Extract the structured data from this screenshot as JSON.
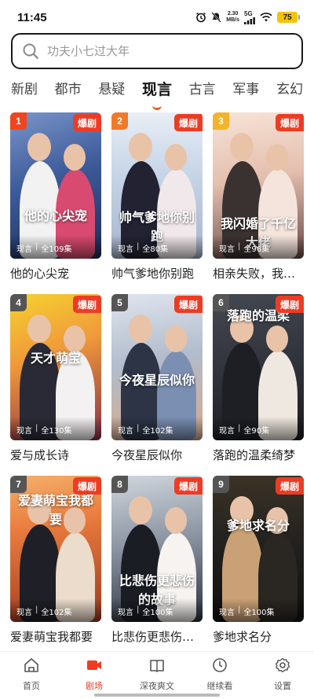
{
  "status_bar": {
    "time": "11:45",
    "net_speed_value": "2.30",
    "net_speed_unit": "MB/s",
    "network": "5G",
    "battery": "75",
    "icons": [
      "alarm-icon",
      "mute-icon",
      "signal-icon",
      "wifi-icon",
      "battery-icon"
    ]
  },
  "search": {
    "placeholder": "功夫小七过大年"
  },
  "tabs": [
    "新剧",
    "都市",
    "悬疑",
    "现言",
    "古言",
    "军事",
    "玄幻"
  ],
  "active_tab": "现言",
  "badge_label": "爆剧",
  "colors": {
    "accent": "#ee3b23",
    "tab_indicator": "#f25a1f",
    "rank_1": "#f0461f",
    "rank_2": "#f07a2a",
    "rank_3": "#f2b42a",
    "rank_other": "#555555"
  },
  "cards": [
    {
      "rank": "1",
      "title": "他的心尖宠",
      "genre": "现言",
      "episodes": "全109集",
      "art_text": "他的心尖宠"
    },
    {
      "rank": "2",
      "title": "帅气爹地你别跑",
      "genre": "现言",
      "episodes": "全80集",
      "art_text": "帅气爹地你别跑"
    },
    {
      "rank": "3",
      "title": "相亲失败，我…",
      "genre": "现言",
      "episodes": "全96集",
      "art_text": "我闪婚了千亿大佬"
    },
    {
      "rank": "4",
      "title": "爱与成长诗",
      "genre": "现言",
      "episodes": "全130集",
      "art_text": "天才萌宝"
    },
    {
      "rank": "5",
      "title": "今夜星辰似你",
      "genre": "现言",
      "episodes": "全102集",
      "art_text": "今夜星辰似你"
    },
    {
      "rank": "6",
      "title": "落跑的温柔绮梦",
      "genre": "现言",
      "episodes": "全90集",
      "art_text": "落跑的温柔"
    },
    {
      "rank": "7",
      "title": "爱妻萌宝我都要",
      "genre": "现言",
      "episodes": "全102集",
      "art_text": "爱妻萌宝我都要"
    },
    {
      "rank": "8",
      "title": "比悲伤更悲伤…",
      "genre": "现言",
      "episodes": "全100集",
      "art_text": "比悲伤更悲伤的故事"
    },
    {
      "rank": "9",
      "title": "爹地求名分",
      "genre": "现言",
      "episodes": "全100集",
      "art_text": "爹地求名分"
    }
  ],
  "bottom_nav": [
    {
      "label": "首页",
      "icon": "home-icon",
      "active": false
    },
    {
      "label": "剧场",
      "icon": "video-icon",
      "active": true
    },
    {
      "label": "深夜爽文",
      "icon": "book-icon",
      "active": false
    },
    {
      "label": "继续看",
      "icon": "clock-icon",
      "active": false
    },
    {
      "label": "设置",
      "icon": "gear-icon",
      "active": false
    }
  ]
}
